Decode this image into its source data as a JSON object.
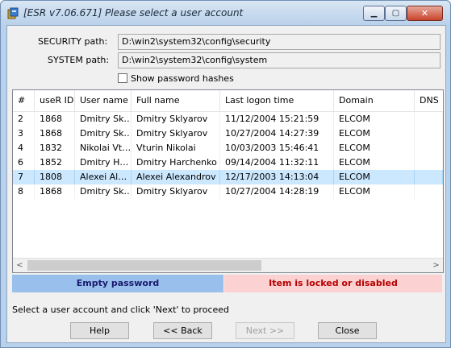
{
  "window": {
    "title": "[ESR v7.06.671]  Please select a user account"
  },
  "paths": {
    "security_label": "SECURITY path:",
    "security_value": "D:\\win2\\system32\\config\\security",
    "system_label": "SYSTEM path:",
    "system_value": "D:\\win2\\system32\\config\\system"
  },
  "show_hashes": {
    "label": "Show password hashes",
    "checked": false
  },
  "table": {
    "columns": [
      "#",
      "useR ID",
      "User name",
      "Full name",
      "Last logon time",
      "Domain",
      "DNS"
    ],
    "rows": [
      [
        "2",
        "1868",
        "Dmitry Sk…",
        "Dmitry Sklyarov",
        "11/12/2004  15:21:59",
        "ELCOM",
        ""
      ],
      [
        "3",
        "1868",
        "Dmitry Sk…",
        "Dmitry Sklyarov",
        "10/27/2004  14:27:39",
        "ELCOM",
        ""
      ],
      [
        "4",
        "1832",
        "Nikolai Vt…",
        "Vturin Nikolai",
        "10/03/2003  15:46:41",
        "ELCOM",
        ""
      ],
      [
        "6",
        "1852",
        "Dmitry H…",
        "Dmitry Harchenko",
        "09/14/2004  11:32:11",
        "ELCOM",
        ""
      ],
      [
        "7",
        "1808",
        "Alexei Al…",
        "Alexei Alexandrov",
        "12/17/2003  14:13:04",
        "ELCOM",
        ""
      ],
      [
        "8",
        "1868",
        "Dmitry Sk…",
        "Dmitry Sklyarov",
        "10/27/2004  14:28:19",
        "ELCOM",
        ""
      ]
    ],
    "selected_row_index": 4
  },
  "legend": {
    "empty": "Empty password",
    "locked": "Item is locked or disabled"
  },
  "status": "Select a user account and click 'Next' to proceed",
  "buttons": {
    "help": "Help",
    "back": "<< Back",
    "next": "Next >>",
    "close": "Close"
  },
  "colors": {
    "empty_bg": "#99c0ec",
    "locked_bg": "#fbd1d1",
    "locked_text": "#b80000",
    "selected_row": "#cce8ff"
  }
}
